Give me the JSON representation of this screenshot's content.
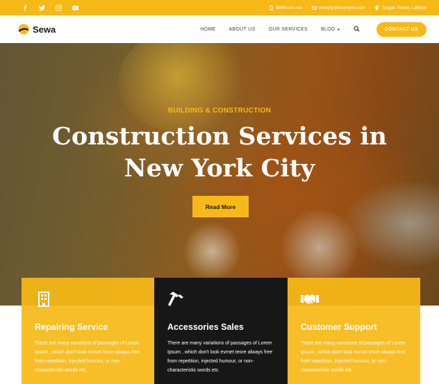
{
  "topbar": {
    "social_icons": [
      "facebook-icon",
      "twitter-icon",
      "instagram-icon",
      "youtube-icon"
    ],
    "phone": "9849-xxx-xxx",
    "email": "noreply@example.com",
    "address": "Tyagal, Patan, Lalitpur",
    "separator": "|"
  },
  "header": {
    "logo_text": "Sewa",
    "nav": [
      "HOME",
      "ABOUT US",
      "OUR SERVICES",
      "BLOG"
    ],
    "cta_label": "CONTACT US"
  },
  "hero": {
    "kicker": "BUILDING & CONSTRUCTION",
    "title": "Construction Services in New York City",
    "button_label": "Read More"
  },
  "services": [
    {
      "icon": "building-icon",
      "title": "Repairing Service",
      "text": "There are many variations of passages of Lorem Ipsum , which don't look evrnet teore always free from repetition, injected humour, or non-characteristic words etc."
    },
    {
      "icon": "hammer-icon",
      "title": "Accessories Sales",
      "text": "There are many variations of passages of Lorem Ipsum , which don't look evrnet teore always free from repetition, injected humour, or non-characteristic words etc."
    },
    {
      "icon": "handshake-icon",
      "title": "Customer Support",
      "text": "There are many variations of passages of Lorem Ipsum , which don't look evrnet teore always free from repetition, injected humour, or non-characteristic words etc."
    }
  ],
  "colors": {
    "accent": "#f7b918",
    "dark_card": "#171717",
    "text_dark": "#1a1a1a"
  }
}
